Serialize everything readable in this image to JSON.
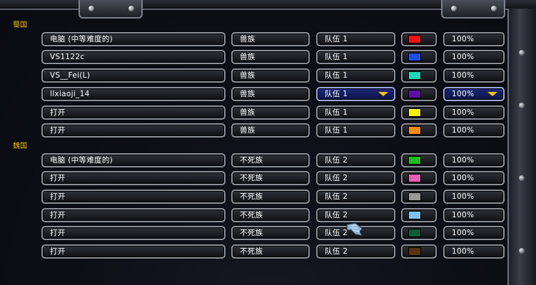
{
  "groups": [
    {
      "label": "蜀国",
      "players": [
        {
          "name": "电脑 (中等难度的)",
          "race": "兽族",
          "team": "队伍 1",
          "color": "#ff1010",
          "handicap": "100%"
        },
        {
          "name": "VS1122c",
          "race": "兽族",
          "team": "队伍 1",
          "color": "#1d4cf0",
          "handicap": "100%"
        },
        {
          "name": "VS__Fei(L)",
          "race": "兽族",
          "team": "队伍 1",
          "color": "#20d8b8",
          "handicap": "100%"
        },
        {
          "name": "llxiaoji_14",
          "race": "兽族",
          "team": "队伍 1",
          "color": "#5a10a8",
          "handicap": "100%",
          "selected": true
        },
        {
          "name": "打开",
          "race": "兽族",
          "team": "队伍 1",
          "color": "#f7f500",
          "handicap": "100%"
        },
        {
          "name": "打开",
          "race": "兽族",
          "team": "队伍 1",
          "color": "#ff8a10",
          "handicap": "100%"
        }
      ]
    },
    {
      "label": "魏国",
      "players": [
        {
          "name": "电脑 (中等难度的)",
          "race": "不死族",
          "team": "队伍 2",
          "color": "#1cbf1c",
          "handicap": "100%"
        },
        {
          "name": "打开",
          "race": "不死族",
          "team": "队伍 2",
          "color": "#e560b0",
          "handicap": "100%"
        },
        {
          "name": "打开",
          "race": "不死族",
          "team": "队伍 2",
          "color": "#9a9a9a",
          "handicap": "100%"
        },
        {
          "name": "打开",
          "race": "不死族",
          "team": "队伍 2",
          "color": "#7ec3f0",
          "handicap": "100%"
        },
        {
          "name": "打开",
          "race": "不死族",
          "team": "队伍 2",
          "color": "#0d5a3c",
          "handicap": "100%"
        },
        {
          "name": "打开",
          "race": "不死族",
          "team": "队伍 2",
          "color": "#5a3310",
          "handicap": "100%"
        }
      ]
    }
  ],
  "icons": {
    "dropdown": "chevron-down-icon",
    "cursor": "gauntlet-cursor-icon"
  }
}
